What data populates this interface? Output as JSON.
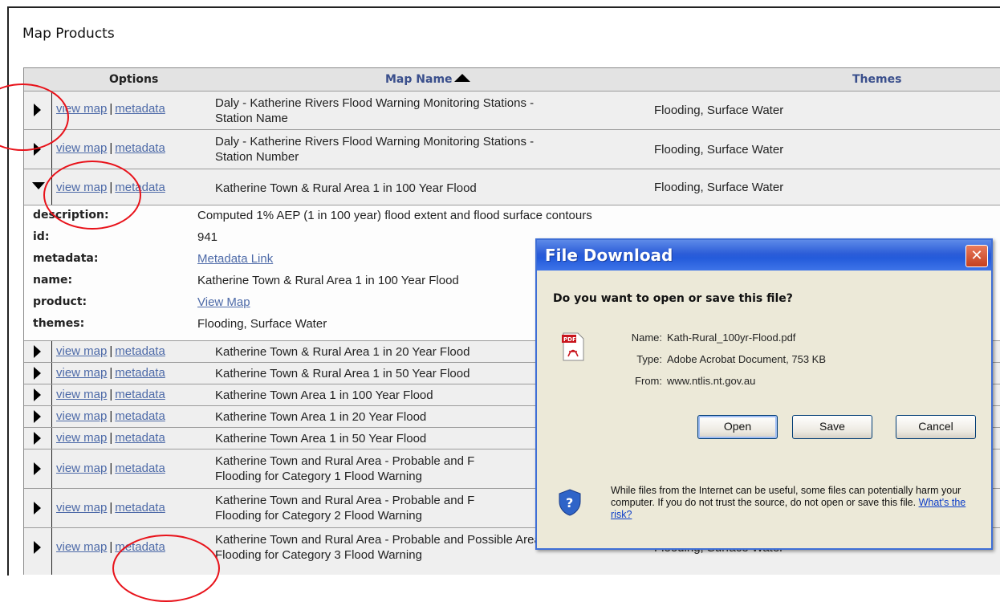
{
  "page": {
    "title": "Map Products"
  },
  "table": {
    "headers": {
      "options": "Options",
      "map_name": "Map Name",
      "themes": "Themes"
    },
    "link_view_map": "view map",
    "link_separator": "|",
    "link_metadata": "metadata",
    "rows": [
      {
        "name_line1": "Daly - Katherine Rivers Flood Warning Monitoring Stations -",
        "name_line2": "Station Name",
        "themes": "Flooding, Surface Water"
      },
      {
        "name_line1": "Daly - Katherine Rivers Flood Warning Monitoring Stations -",
        "name_line2": "Station Number",
        "themes": "Flooding, Surface Water"
      },
      {
        "name_line1": "Katherine Town & Rural Area 1 in 100 Year Flood",
        "themes": "Flooding, Surface Water"
      },
      {
        "name_line1": "Katherine Town & Rural Area 1 in 20 Year Flood"
      },
      {
        "name_line1": "Katherine Town & Rural Area 1 in 50 Year Flood"
      },
      {
        "name_line1": "Katherine Town Area 1 in 100 Year Flood"
      },
      {
        "name_line1": "Katherine Town Area 1 in 20 Year Flood"
      },
      {
        "name_line1": "Katherine Town Area 1 in 50 Year Flood"
      },
      {
        "name_line1": "Katherine Town and Rural Area - Probable and F",
        "name_line2": "Flooding for Category 1 Flood Warning"
      },
      {
        "name_line1": "Katherine Town and Rural Area - Probable and F",
        "name_line2": "Flooding for Category 2 Flood Warning"
      },
      {
        "name_line1": "Katherine Town and Rural Area - Probable and Possible Areas of",
        "name_line2": "Flooding for Category 3 Flood Warning",
        "themes": "Flooding, Surface Water"
      }
    ],
    "detail": {
      "description_label": "description:",
      "description": "Computed 1% AEP (1 in 100 year) flood extent and flood surface contours",
      "id_label": "id:",
      "id": "941",
      "metadata_label": "metadata:",
      "metadata_link": "Metadata Link",
      "name_label": "name:",
      "name": "Katherine Town & Rural Area 1 in 100 Year Flood",
      "product_label": "product:",
      "product_link": "View Map",
      "themes_label": "themes:",
      "themes": "Flooding, Surface Water"
    }
  },
  "dialog": {
    "title": "File Download",
    "close_glyph": "✕",
    "question": "Do you want to open or save this file?",
    "pdf_icon_text": "PDF",
    "name_label": "Name:",
    "name": "Kath-Rural_100yr-Flood.pdf",
    "type_label": "Type:",
    "type": "Adobe Acrobat Document, 753 KB",
    "from_label": "From:",
    "from": "www.ntlis.nt.gov.au",
    "buttons": {
      "open": "Open",
      "save": "Save",
      "cancel": "Cancel"
    },
    "warning": "While files from the Internet can be useful, some files can potentially harm your computer. If you do not trust the source, do not open or save this file.",
    "risk_link": "What's the risk?"
  },
  "colors": {
    "annotation_circle": "#e8121a",
    "link": "#4d6aa8",
    "dialog_title_bar": "#245bdb",
    "dialog_body": "#ece9d8"
  }
}
